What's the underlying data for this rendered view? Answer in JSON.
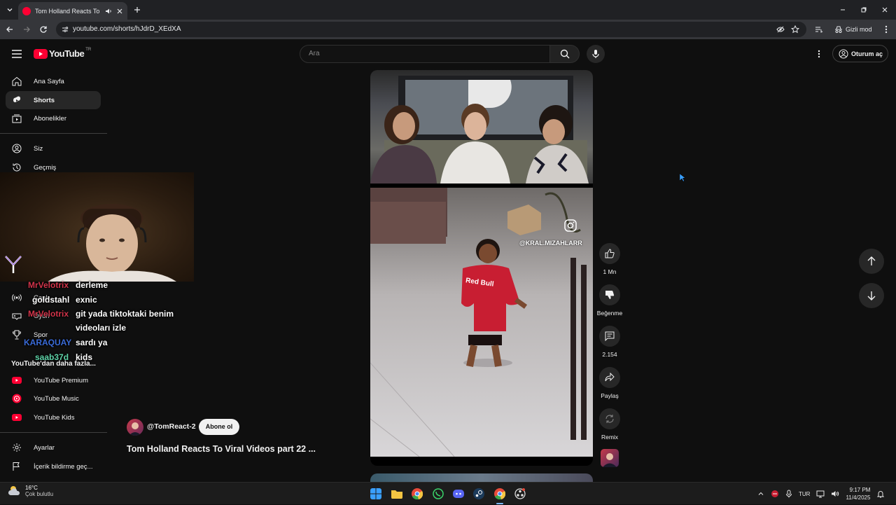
{
  "browser": {
    "tab_title": "Tom Holland Reacts To Viral",
    "url": "youtube.com/shorts/hJdrD_XEdXA",
    "incognito_label": "Gizli mod"
  },
  "header": {
    "logo_text": "YouTube",
    "region": "TR",
    "search_placeholder": "Ara",
    "signin_label": "Oturum aç"
  },
  "sidebar": {
    "items": [
      {
        "label": "Ana Sayfa",
        "icon": "home-icon"
      },
      {
        "label": "Shorts",
        "icon": "shorts-icon"
      },
      {
        "label": "Abonelikler",
        "icon": "subscriptions-icon"
      },
      {
        "label": "Siz",
        "icon": "person-icon"
      },
      {
        "label": "Geçmiş",
        "icon": "history-icon"
      }
    ],
    "explore_items": [
      {
        "label": "Canlı",
        "icon": "live-icon"
      },
      {
        "label": "Oyun",
        "icon": "gaming-icon"
      },
      {
        "label": "Spor",
        "icon": "trophy-icon"
      }
    ],
    "more_heading": "YouTube'dan daha fazla...",
    "more_items": [
      {
        "label": "YouTube Premium"
      },
      {
        "label": "YouTube Music"
      },
      {
        "label": "YouTube Kids"
      }
    ],
    "footer_items": [
      {
        "label": "Ayarlar",
        "icon": "settings-icon"
      },
      {
        "label": "İçerik bildirme geç...",
        "icon": "flag-icon"
      }
    ]
  },
  "chat": [
    {
      "user": "MrVelotrix",
      "message": "derleme",
      "color": "#d3344a"
    },
    {
      "user": "goldstahl",
      "message": "exnic",
      "color": "#ffffff"
    },
    {
      "user": "MrVelotrix",
      "message": "git yada tiktoktaki benim",
      "color": "#d3344a"
    },
    {
      "user": "",
      "message": "videoları izle",
      "color": "#ffffff"
    },
    {
      "user": "KARAQUAY",
      "message": "sardı ya",
      "color": "#3a6bd8"
    },
    {
      "user": "saab37d",
      "message": "kids",
      "color": "#5fd3a8"
    }
  ],
  "short": {
    "channel": "@TomReact-2",
    "subscribe_label": "Abone ol",
    "title": "Tom Holland Reacts To Viral Videos part 22 ...",
    "watermark": "@KRAL.MIZAHLARR",
    "shirt_text": "Red Bull"
  },
  "actions": {
    "like_count": "1 Mn",
    "dislike_label": "Beğenme",
    "comment_count": "2.154",
    "share_label": "Paylaş",
    "remix_label": "Remix"
  },
  "taskbar": {
    "temperature": "16°C",
    "weather": "Çok bulutlu",
    "language": "TUR",
    "time": "9:17 PM",
    "date": "11/4/2025"
  },
  "colors": {
    "youtube_red": "#ff0033",
    "background": "#0f0f0f"
  }
}
